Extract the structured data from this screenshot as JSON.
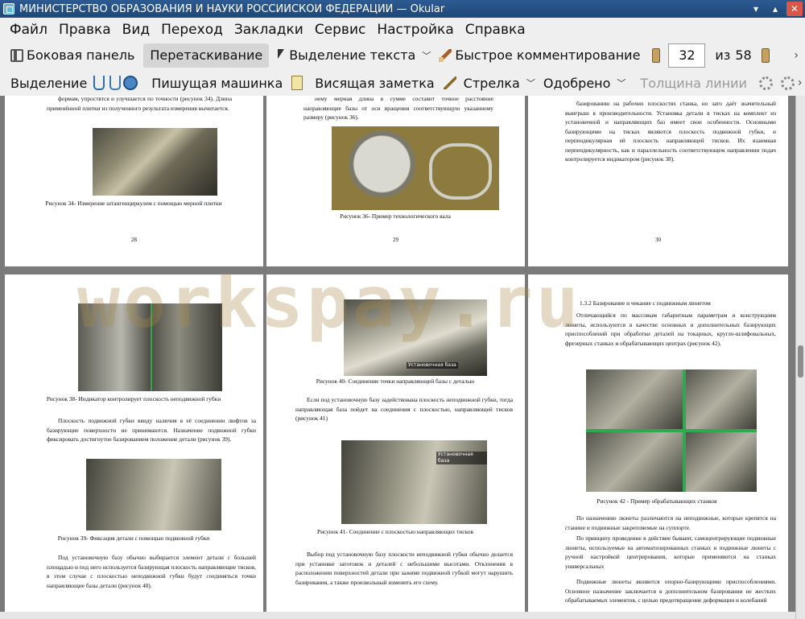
{
  "window": {
    "title": "МИНИСТЕРСТВО ОБРАЗОВАНИЯ И НАУКИ РОССИЙСКОЙ ФЕДЕРАЦИИ  — Okular",
    "minimize": "▾",
    "maximize": "▴",
    "close": "✕"
  },
  "menu": [
    "Файл",
    "Правка",
    "Вид",
    "Переход",
    "Закладки",
    "Сервис",
    "Настройка",
    "Справка"
  ],
  "toolbar1": {
    "sidebar": "Боковая панель",
    "drag": "Перетаскивание",
    "text_select": "Выделение текста",
    "quick_comment": "Быстрое комментирование",
    "page_current": "32",
    "page_of": "из",
    "page_total": "58",
    "more": "›"
  },
  "toolbar2": {
    "select": "Выделение",
    "typewriter": "Пишущая машинка",
    "hanging_note": "Висящая заметка",
    "arrow": "Стрелка",
    "approved": "Одобрено",
    "line_width": "Толщина линии",
    "more": "›"
  },
  "pages": {
    "p28": {
      "text": "формам, упростятся и улучшается по точности (рисунок 34). Длина применённой плитки из полученного результата измерения вычитается.",
      "caption": "Рисунок 34- Измерение штангенциркулем с помощью мерной плитки",
      "num": "28"
    },
    "p29": {
      "text": "нему мерная длина в сумме составит точное расстояние направляющие базы от оси вращения соответствующую указанному размеру (рисунок 36).",
      "caption": "Рисунок 36- Пример технологического вала",
      "num": "29"
    },
    "p30": {
      "text": "базированию на рабочих плоскостях станка, но зато даёт значительный выигрыш в производительности. Установка детали в тисках на комплект из установочной и направляющих баз имеет свои особенности. Основными базирующими на тисках являются плоскость подвижной губки, и перпендикулярная ей плоскость направляющей тисков. Их взаимная перпендикулярность, как и параллельность соответствующем направлении подач контролируется индикатором (рисунок 38).",
      "num": "30"
    },
    "p31": {
      "caption1": "Рисунок 38- Индикатор контролирует плоскость неподвижной губки",
      "text1": "Плоскость подвижной губки ввиду наличия в её соединении люфтов за базирующие поверхности не принимаются. Назначение подвижной губки фиксировать достигнутое базированием положение детали (рисунок 39).",
      "caption2": "Рисунок 39- Фиксация детали с помощью подвижной губки",
      "text2": "Под установочную базу обычно выбирается элемент детали с большей площадью и под него используется базирующая плоскость направляющие тисков, в этом случае с плоскостью неподвижной губки будут соединяться точки направляющие базы детали (рисунок 40)."
    },
    "p32": {
      "photo_label1": "Установочная база",
      "caption1": "Рисунок 40- Соединение точки направляющей базы с деталью",
      "text1": "Если под установочную базу задействована плоскость неподвижной губки, тогда направляющая база пойдет на соединения с плоскостью, направляющей тисков (рисунок 41)",
      "photo_label2": "Установочная база",
      "caption2": "Рисунок 41- Соединение с плоскостью направляющих тисков",
      "text2": "Выбор под установочную базу плоскости неподвижной губки обычно делается при установке заготовок и деталей с небольшими высотами. Отклонения в расположении поверхностей детали при зажиме подвижной губкой могут нарушить базирования, а также произвольный изменить его схему."
    },
    "p33": {
      "heading": "1.3.2 Базирование и чекание с подвижным люнетом",
      "text1": "Отличающийся по массовым габаритным параметрам и конструкциям люнеты, используются в качестве основных и дополнительных базирующих приспособлений при обработки деталей на токарных, кругло-шлифовальных, фрезерных станках и обрабатывающих центрах (рисунок 42).",
      "caption": "Рисунок 42 - Пример обрабатывающих станков",
      "text2": "По назначению люнеты различаются на неподвижные, которые крепятся на станине и подвижные закрепляемые на суппорте.",
      "text3": "По принципу проведение в действие бывают, самоцентрирующие подвижные люнеты, используемые на автоматизированных станках и подвижные люнеты с ручной настройкой центрирования, которые применяются на станках универсальных",
      "text4": "Подвижные люнеты являются опорно-базирующими приспособлениями. Основное назначение заключается в дополнительном базировании не жестких обрабатываемых элементов, с целью предотвращение деформации и колебаний"
    }
  },
  "watermark": "workspay.ru",
  "colors": {
    "titlebar": "#1f4778",
    "toolbar_bg": "#efefef",
    "document_bg": "#7a7a7a",
    "photo_divider": "#2fa84f",
    "watermark": "#a88846"
  }
}
